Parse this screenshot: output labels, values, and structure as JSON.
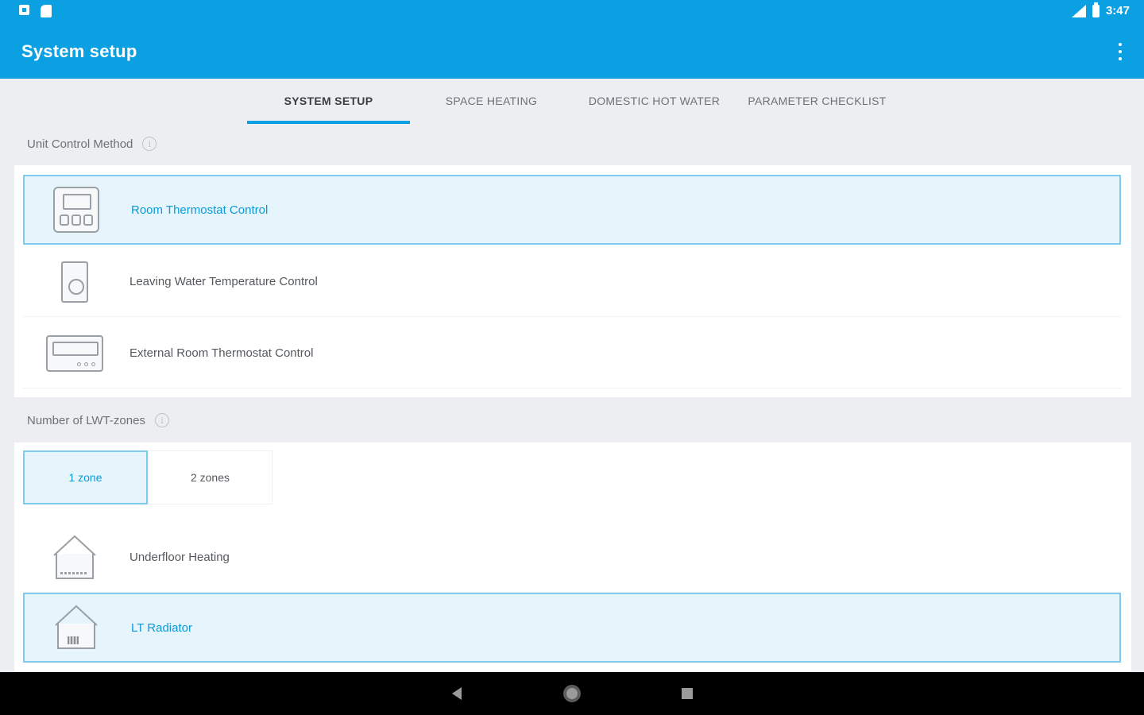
{
  "status_bar": {
    "time": "3:47",
    "left_icons": [
      "notification-square-icon",
      "sd-card-icon"
    ],
    "right_icons": [
      "signal-icon",
      "battery-icon"
    ]
  },
  "app_bar": {
    "title": "System setup",
    "menu_icon": "overflow-menu-icon"
  },
  "tabs": [
    {
      "label": "SYSTEM SETUP",
      "active": true
    },
    {
      "label": "SPACE HEATING",
      "active": false
    },
    {
      "label": "DOMESTIC HOT WATER",
      "active": false
    },
    {
      "label": "PARAMETER CHECKLIST",
      "active": false
    }
  ],
  "unit_control": {
    "label": "Unit Control Method",
    "info_glyph": "i",
    "options": [
      {
        "label": "Room Thermostat Control",
        "selected": true
      },
      {
        "label": "Leaving Water Temperature Control",
        "selected": false
      },
      {
        "label": "External Room Thermostat Control",
        "selected": false
      }
    ]
  },
  "lwt_zones": {
    "label": "Number of LWT-zones",
    "info_glyph": "i",
    "zone_options": [
      {
        "label": "1 zone",
        "selected": true
      },
      {
        "label": "2 zones",
        "selected": false
      }
    ],
    "emitters": [
      {
        "label": "Underfloor Heating",
        "selected": false
      },
      {
        "label": "LT Radiator",
        "selected": true
      }
    ]
  },
  "colors": {
    "accent": "#0aa0e2",
    "selected_bg": "#e6f4fc",
    "selected_border": "#7fcbee",
    "page_bg": "#eceef1"
  }
}
